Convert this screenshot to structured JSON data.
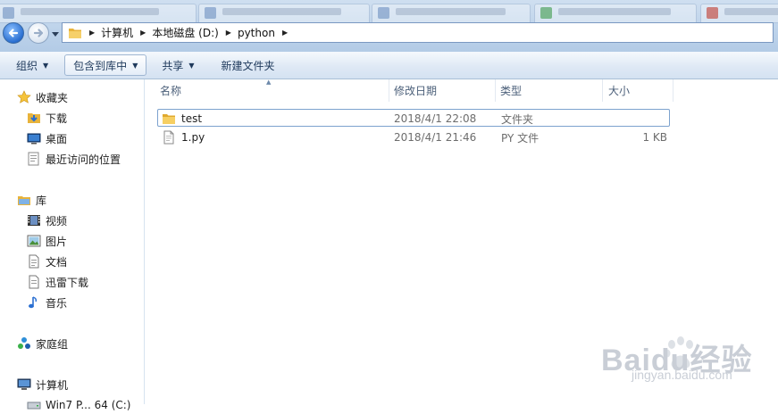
{
  "address": {
    "breadcrumbs": [
      "计算机",
      "本地磁盘 (D:)",
      "python"
    ]
  },
  "toolbar": {
    "organize": "组织",
    "include_in_library": "包含到库中",
    "share": "共享",
    "new_folder": "新建文件夹"
  },
  "nav": {
    "favorites": "收藏夹",
    "downloads": "下载",
    "desktop": "桌面",
    "recent": "最近访问的位置",
    "libraries": "库",
    "videos": "视频",
    "pictures": "图片",
    "documents": "文档",
    "thunder": "迅雷下载",
    "music": "音乐",
    "homegroup": "家庭组",
    "computer": "计算机",
    "drive_partial": "Win7 P... 64 (C:)"
  },
  "columns": {
    "name": "名称",
    "date": "修改日期",
    "type": "类型",
    "size": "大小"
  },
  "files": [
    {
      "name": "test",
      "date": "2018/4/1 22:08",
      "type": "文件夹",
      "size": ""
    },
    {
      "name": "1.py",
      "date": "2018/4/1 21:46",
      "type": "PY 文件",
      "size": "1 KB"
    }
  ],
  "watermark": {
    "text": "Baidu经验",
    "sub": "jingyan.baidu.com"
  },
  "colors": {
    "accent": "#2a6fd1",
    "selection_border": "#7da2ce",
    "folder": "#e8b33b"
  }
}
